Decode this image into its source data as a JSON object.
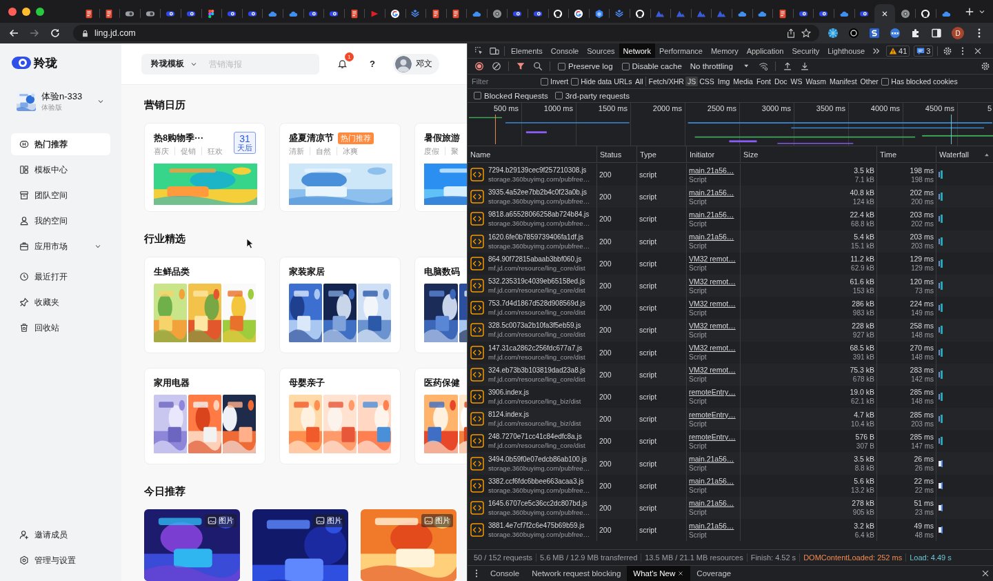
{
  "browser": {
    "tabs": [
      {
        "kind": "red",
        "selected": false
      },
      {
        "kind": "red",
        "selected": false
      },
      {
        "kind": "toggle",
        "selected": false
      },
      {
        "kind": "toggle",
        "selected": false
      },
      {
        "kind": "eye",
        "selected": false
      },
      {
        "kind": "eye",
        "selected": false
      },
      {
        "kind": "figma",
        "selected": false
      },
      {
        "kind": "eye",
        "selected": false
      },
      {
        "kind": "eye",
        "selected": false
      },
      {
        "kind": "cloud",
        "selected": false
      },
      {
        "kind": "cloud",
        "selected": false
      },
      {
        "kind": "eye",
        "selected": false
      },
      {
        "kind": "eye",
        "selected": false
      },
      {
        "kind": "red",
        "selected": false
      },
      {
        "kind": "play",
        "selected": false
      },
      {
        "kind": "google",
        "selected": false
      },
      {
        "kind": "layers",
        "selected": false
      },
      {
        "kind": "red",
        "selected": false
      },
      {
        "kind": "red",
        "selected": false
      },
      {
        "kind": "cloud",
        "selected": false
      },
      {
        "kind": "chrome",
        "selected": false
      },
      {
        "kind": "eye",
        "selected": false
      },
      {
        "kind": "eye",
        "selected": false
      },
      {
        "kind": "github",
        "selected": false
      },
      {
        "kind": "google",
        "selected": false
      },
      {
        "kind": "cube",
        "selected": false
      },
      {
        "kind": "layers",
        "selected": false
      },
      {
        "kind": "github",
        "selected": false
      },
      {
        "kind": "mountain",
        "selected": false
      },
      {
        "kind": "mountain",
        "selected": false
      },
      {
        "kind": "mountain",
        "selected": false
      },
      {
        "kind": "mountain",
        "selected": false
      },
      {
        "kind": "cloud",
        "selected": false
      },
      {
        "kind": "cloud",
        "selected": false
      },
      {
        "kind": "red",
        "selected": false
      },
      {
        "kind": "eye",
        "selected": false
      },
      {
        "kind": "eye",
        "selected": false
      },
      {
        "kind": "cloud",
        "selected": false
      },
      {
        "kind": "eye",
        "selected": false
      },
      {
        "selected": true
      },
      {
        "kind": "chrome",
        "selected": false
      },
      {
        "kind": "github",
        "selected": false
      },
      {
        "kind": "cloud",
        "selected": false
      }
    ],
    "url": "ling.jd.com",
    "profile_initial": "D"
  },
  "app": {
    "logo": "羚珑",
    "workspace": {
      "name": "体验n-333",
      "plan": "体验版"
    },
    "main_nav": [
      {
        "kind": "hot",
        "label": "热门推荐",
        "selected": true
      },
      {
        "kind": "templates",
        "label": "模板中心",
        "selected": false
      },
      {
        "kind": "team",
        "label": "团队空间",
        "selected": false
      },
      {
        "kind": "personal",
        "label": "我的空间",
        "selected": false
      },
      {
        "kind": "market",
        "label": "应用市场",
        "selected": false,
        "expanded": false
      }
    ],
    "secondary_nav": [
      {
        "kind": "recent",
        "label": "最近打开",
        "selected": false
      },
      {
        "kind": "favorites",
        "label": "收藏夹",
        "selected": false
      },
      {
        "kind": "trash",
        "label": "回收站",
        "selected": false
      }
    ],
    "footer_nav": [
      {
        "kind": "invite",
        "label": "邀请成员",
        "selected": false
      },
      {
        "kind": "settings",
        "label": "管理与设置",
        "selected": false
      }
    ],
    "header": {
      "scope": "羚珑模板",
      "placeholder": "营销海报",
      "notifications": "1",
      "help": "?",
      "user": "邓文"
    },
    "calendar": {
      "title": "营销日历",
      "cards": [
        {
          "title": "热8购物季···",
          "countdown": {
            "number": "31",
            "unit": "天后"
          },
          "keywords": [
            "喜庆",
            "促销",
            "狂欢"
          ]
        },
        {
          "title": "盛夏清凉节",
          "tag": "热门推荐",
          "keywords": [
            "清新",
            "自然",
            "冰爽"
          ]
        },
        {
          "title": "暑假旅游",
          "keywords": [
            "度假",
            "聚"
          ]
        }
      ]
    },
    "industry": {
      "title": "行业精选",
      "cards": [
        {
          "title": "生鲜品类"
        },
        {
          "title": "家装家居"
        },
        {
          "title": "电脑数码"
        },
        {
          "title": "家用电器"
        },
        {
          "title": "母婴亲子"
        },
        {
          "title": "医药保健"
        }
      ]
    },
    "today": {
      "title": "今日推荐",
      "cards": [
        {
          "badge": "图片"
        },
        {
          "badge": "图片"
        },
        {
          "badge": "图片"
        }
      ]
    }
  },
  "devtools": {
    "panel_tabs": [
      {
        "label": "Elements",
        "selected": false
      },
      {
        "label": "Console",
        "selected": false
      },
      {
        "label": "Sources",
        "selected": false
      },
      {
        "label": "Network",
        "selected": true
      },
      {
        "label": "Performance",
        "selected": false
      },
      {
        "label": "Memory",
        "selected": false
      },
      {
        "label": "Application",
        "selected": false
      },
      {
        "label": "Security",
        "selected": false
      },
      {
        "label": "Lighthouse",
        "selected": false
      }
    ],
    "warnings": "41",
    "messages": "3",
    "toolbar": {
      "checks": [
        {
          "label": "Preserve log",
          "checked": false
        },
        {
          "label": "Disable cache",
          "checked": false
        }
      ],
      "throttling": "No throttling"
    },
    "filter": {
      "placeholder": "Filter",
      "checks": [
        {
          "label": "Invert",
          "checked": false
        },
        {
          "label": "Hide data URLs",
          "checked": false
        }
      ],
      "types": [
        {
          "label": "All",
          "selected": false
        },
        {
          "label": "Fetch/XHR",
          "selected": false
        },
        {
          "label": "JS",
          "selected": true
        },
        {
          "label": "CSS",
          "selected": false
        },
        {
          "label": "Img",
          "selected": false
        },
        {
          "label": "Media",
          "selected": false
        },
        {
          "label": "Font",
          "selected": false
        },
        {
          "label": "Doc",
          "selected": false
        },
        {
          "label": "WS",
          "selected": false
        },
        {
          "label": "Wasm",
          "selected": false
        },
        {
          "label": "Manifest",
          "selected": false
        },
        {
          "label": "Other",
          "selected": false
        }
      ],
      "end_check": {
        "label": "Has blocked cookies",
        "checked": false
      },
      "more_checks": [
        {
          "label": "Blocked Requests",
          "checked": false
        },
        {
          "label": "3rd-party requests",
          "checked": false
        }
      ]
    },
    "overview_ticks": [
      "500 ms",
      "1000 ms",
      "1500 ms",
      "2000 ms",
      "2500 ms",
      "3000 ms",
      "3500 ms",
      "4000 ms",
      "4500 ms",
      "5"
    ],
    "columns": [
      "Name",
      "Status",
      "Type",
      "Initiator",
      "Size",
      "Time",
      "Waterfall"
    ],
    "rows": [
      {
        "name": "7294.b29139cec9f257210308.js",
        "domain": "storage.360buyimg.com/pubfree…",
        "status": "200",
        "type": "script",
        "initiator": "main.21a56…",
        "initiator_type": "Script",
        "size": "3.5 kB",
        "resource_size": "7.1 kB",
        "time": "198 ms",
        "latency": "198 ms"
      },
      {
        "name": "3935.4a52ee7bb2b4c0f23a0b.js",
        "domain": "storage.360buyimg.com/pubfree…",
        "status": "200",
        "type": "script",
        "initiator": "main.21a56…",
        "initiator_type": "Script",
        "size": "40.8 kB",
        "resource_size": "124 kB",
        "time": "202 ms",
        "latency": "200 ms"
      },
      {
        "name": "9818.a65528066258ab724b84.js",
        "domain": "storage.360buyimg.com/pubfree…",
        "status": "200",
        "type": "script",
        "initiator": "main.21a56…",
        "initiator_type": "Script",
        "size": "22.4 kB",
        "resource_size": "68.8 kB",
        "time": "203 ms",
        "latency": "202 ms"
      },
      {
        "name": "1620.6fe0b7859739406fa1df.js",
        "domain": "storage.360buyimg.com/pubfree…",
        "status": "200",
        "type": "script",
        "initiator": "main.21a56…",
        "initiator_type": "Script",
        "size": "5.4 kB",
        "resource_size": "15.1 kB",
        "time": "203 ms",
        "latency": "203 ms"
      },
      {
        "name": "864.90f72815abaab3bbf060.js",
        "domain": "mf.jd.com/resource/ling_core/dist",
        "status": "200",
        "type": "script",
        "initiator": "VM32 remot…",
        "initiator_type": "Script",
        "size": "11.2 kB",
        "resource_size": "62.9 kB",
        "time": "129 ms",
        "latency": "129 ms"
      },
      {
        "name": "532.235319c4039eb65158ed.js",
        "domain": "mf.jd.com/resource/ling_core/dist",
        "status": "200",
        "type": "script",
        "initiator": "VM32 remot…",
        "initiator_type": "Script",
        "size": "61.6 kB",
        "resource_size": "153 kB",
        "time": "120 ms",
        "latency": "73 ms"
      },
      {
        "name": "753.7d4d1867d528d908569d.js",
        "domain": "mf.jd.com/resource/ling_core/dist",
        "status": "200",
        "type": "script",
        "initiator": "VM32 remot…",
        "initiator_type": "Script",
        "size": "286 kB",
        "resource_size": "983 kB",
        "time": "224 ms",
        "latency": "149 ms"
      },
      {
        "name": "328.5c0073a2b10fa3f5eb59.js",
        "domain": "mf.jd.com/resource/ling_core/dist",
        "status": "200",
        "type": "script",
        "initiator": "VM32 remot…",
        "initiator_type": "Script",
        "size": "228 kB",
        "resource_size": "927 kB",
        "time": "258 ms",
        "latency": "148 ms"
      },
      {
        "name": "147.31ca2862c256fdc677a7.js",
        "domain": "mf.jd.com/resource/ling_core/dist",
        "status": "200",
        "type": "script",
        "initiator": "VM32 remot…",
        "initiator_type": "Script",
        "size": "68.5 kB",
        "resource_size": "391 kB",
        "time": "270 ms",
        "latency": "148 ms"
      },
      {
        "name": "324.eb73b3b103819dad23a8.js",
        "domain": "mf.jd.com/resource/ling_core/dist",
        "status": "200",
        "type": "script",
        "initiator": "VM32 remot…",
        "initiator_type": "Script",
        "size": "75.3 kB",
        "resource_size": "678 kB",
        "time": "283 ms",
        "latency": "142 ms"
      },
      {
        "name": "3906.index.js",
        "domain": "mf.jd.com/resource/ling_biz/dist",
        "status": "200",
        "type": "script",
        "initiator": "remoteEntry…",
        "initiator_type": "Script",
        "size": "19.0 kB",
        "resource_size": "62.1 kB",
        "time": "285 ms",
        "latency": "148 ms"
      },
      {
        "name": "8124.index.js",
        "domain": "mf.jd.com/resource/ling_biz/dist",
        "status": "200",
        "type": "script",
        "initiator": "remoteEntry…",
        "initiator_type": "Script",
        "size": "4.7 kB",
        "resource_size": "10.4 kB",
        "time": "285 ms",
        "latency": "203 ms"
      },
      {
        "name": "248.7270e71cc41c84edfc8a.js",
        "domain": "mf.jd.com/resource/ling_core/dist",
        "status": "200",
        "type": "script",
        "initiator": "remoteEntry…",
        "initiator_type": "Script",
        "size": "576 B",
        "resource_size": "307 B",
        "time": "285 ms",
        "latency": "147 ms"
      },
      {
        "name": "3494.0b59f0e07edcb86ab100.js",
        "domain": "storage.360buyimg.com/pubfree…",
        "status": "200",
        "type": "script",
        "initiator": "main.21a56…",
        "initiator_type": "Script",
        "size": "3.5 kB",
        "resource_size": "8.8 kB",
        "time": "26 ms",
        "latency": "26 ms"
      },
      {
        "name": "3382.ccf6fdc6bbee663acaa3.js",
        "domain": "storage.360buyimg.com/pubfree…",
        "status": "200",
        "type": "script",
        "initiator": "main.21a56…",
        "initiator_type": "Script",
        "size": "5.6 kB",
        "resource_size": "13.2 kB",
        "time": "22 ms",
        "latency": "22 ms"
      },
      {
        "name": "1645.6707ce5c36cc2dc807bd.js",
        "domain": "storage.360buyimg.com/pubfree…",
        "status": "200",
        "type": "script",
        "initiator": "main.21a56…",
        "initiator_type": "Script",
        "size": "278 kB",
        "resource_size": "905 kB",
        "time": "51 ms",
        "latency": "23 ms"
      },
      {
        "name": "3881.4e7cf7f2c6e475b69b59.js",
        "domain": "storage.360buyimg.com/pubfree…",
        "status": "200",
        "type": "script",
        "initiator": "main.21a56…",
        "initiator_type": "Script",
        "size": "3.2 kB",
        "resource_size": "6.4 kB",
        "time": "49 ms",
        "latency": "48 ms"
      }
    ],
    "summary": [
      {
        "kind": "plain",
        "text": "50 / 152 requests"
      },
      {
        "kind": "plain",
        "text": "5.6 MB / 12.9 MB transferred"
      },
      {
        "kind": "plain",
        "text": "13.5 MB / 21.1 MB resources"
      },
      {
        "kind": "plain",
        "text": "Finish: 4.52 s"
      },
      {
        "kind": "dom",
        "text": "DOMContentLoaded: 252 ms"
      },
      {
        "kind": "load",
        "text": "Load: 4.49 s"
      }
    ],
    "drawer_tabs": [
      {
        "label": "Console",
        "selected": false
      },
      {
        "label": "Network request blocking",
        "selected": false
      },
      {
        "label": "What's New",
        "selected": true
      },
      {
        "label": "Coverage",
        "selected": false
      }
    ]
  }
}
